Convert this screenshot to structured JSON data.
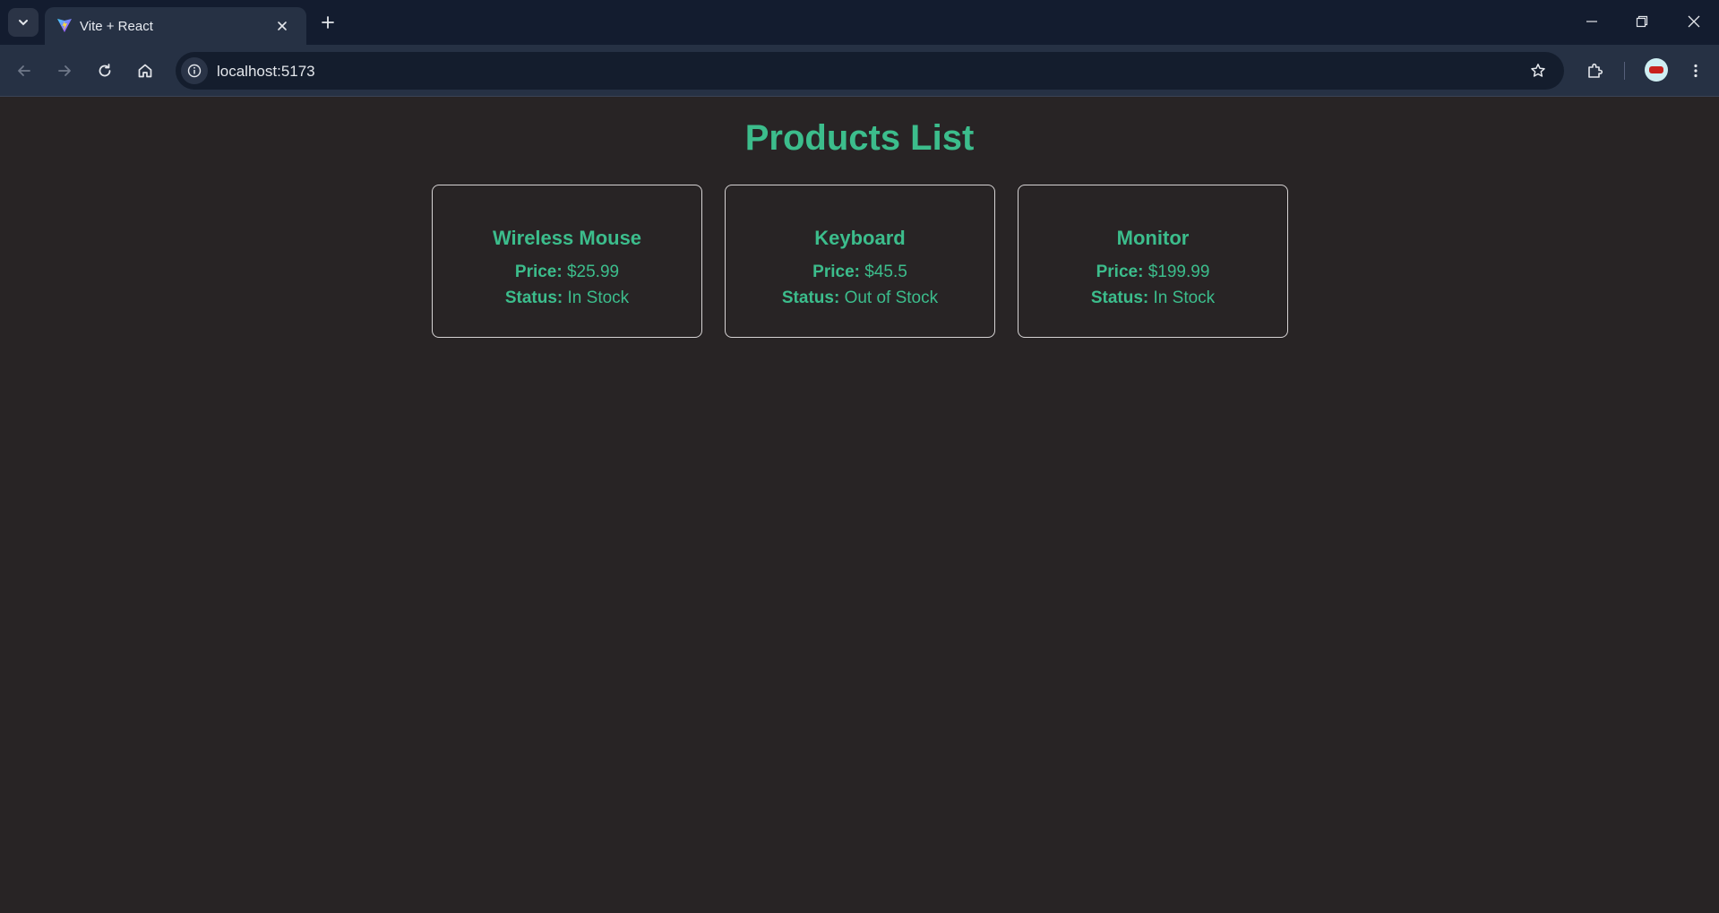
{
  "browser": {
    "tab": {
      "title": "Vite + React"
    },
    "address_bar": {
      "url": "localhost:5173"
    }
  },
  "page": {
    "title": "Products List",
    "price_label": "Price:",
    "status_label": "Status:",
    "products": [
      {
        "name": "Wireless Mouse",
        "price": "$25.99",
        "status": "In Stock"
      },
      {
        "name": "Keyboard",
        "price": "$45.5",
        "status": "Out of Stock"
      },
      {
        "name": "Monitor",
        "price": "$199.99",
        "status": "In Stock"
      }
    ]
  },
  "colors": {
    "accent": "#3cbd8c",
    "page_background": "#282425",
    "card_border": "#d6d3d4",
    "browser_frame": "#131c2f",
    "toolbar": "#263144"
  }
}
